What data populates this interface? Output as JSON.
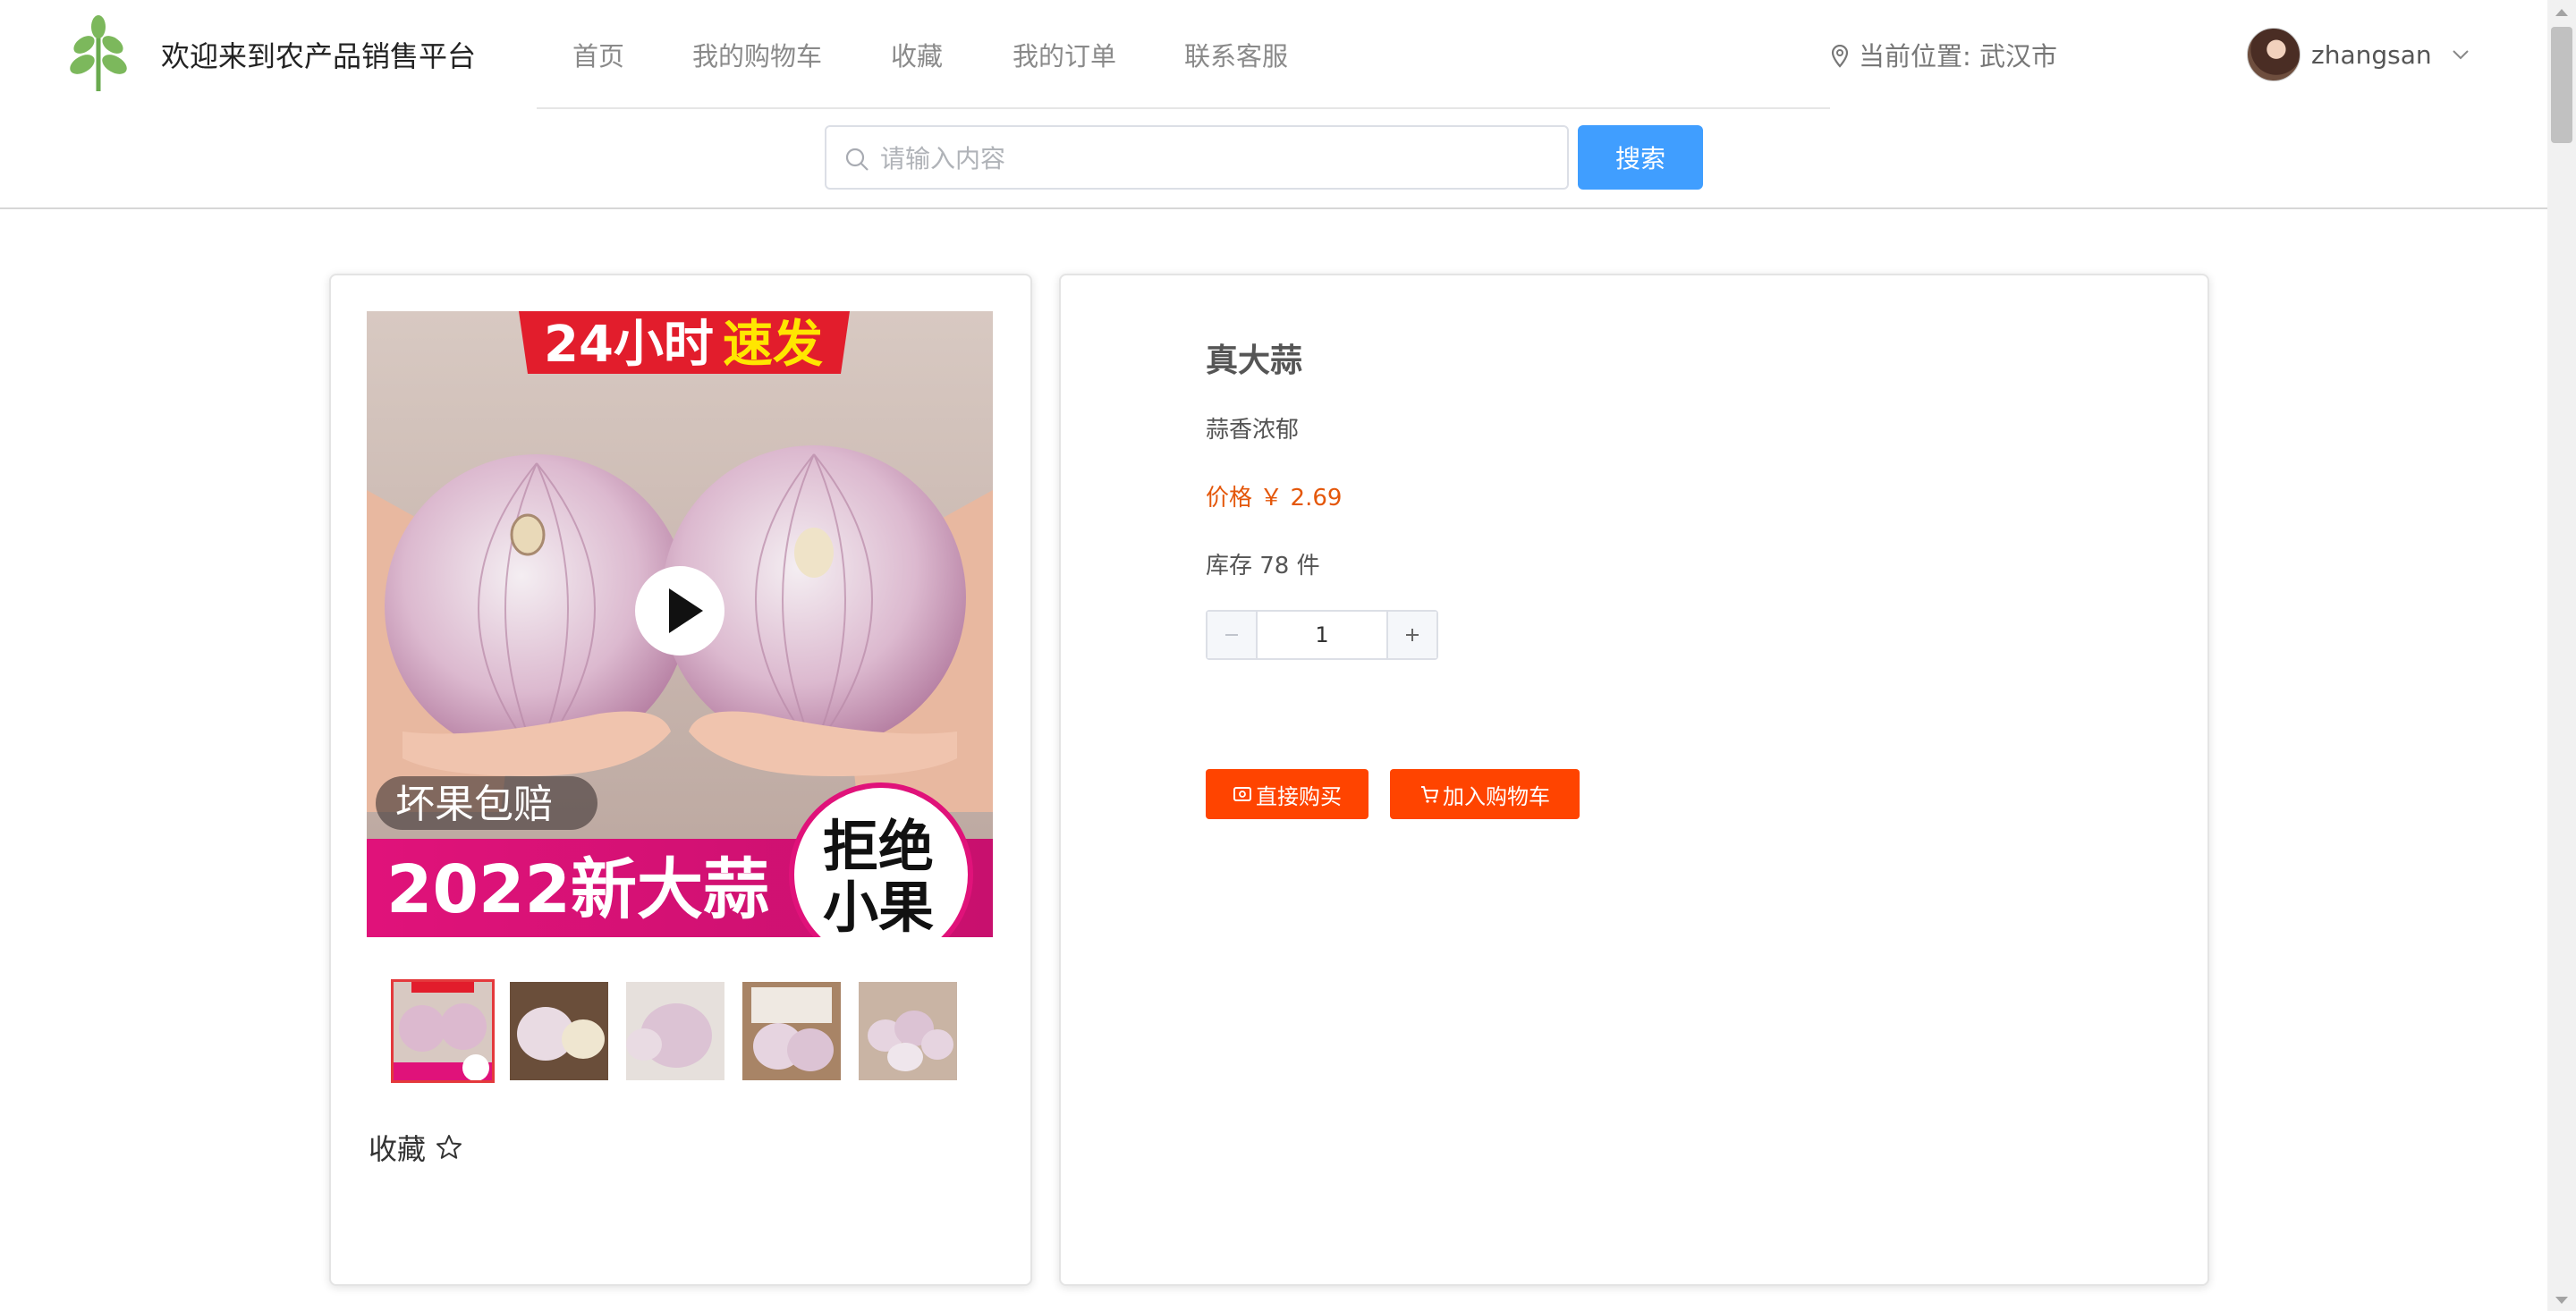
{
  "header": {
    "site_title": "欢迎来到农产品销售平台",
    "nav": [
      "首页",
      "我的购物车",
      "收藏",
      "我的订单",
      "联系客服"
    ],
    "location": "当前位置: 武汉市",
    "username": "zhangsan",
    "search_placeholder": "请输入内容",
    "search_button": "搜索",
    "logo_icon": "leaf-icon"
  },
  "gallery": {
    "main_banner_top": "24小时",
    "main_banner_top_highlight": "速发",
    "main_tag": "坏果包赔",
    "main_bottom": "2022新大蒜",
    "main_badge_line1": "拒绝",
    "main_badge_line2": "小果",
    "thumb_count": 5,
    "favorite_label": "收藏"
  },
  "product": {
    "name": "真大蒜",
    "description": "蒜香浓郁",
    "price_text": "价格 ￥ 2.69",
    "stock_text": "库存 78 件",
    "quantity": "1",
    "buy_now_label": "直接购买",
    "add_to_cart_label": "加入购物车"
  },
  "colors": {
    "accent_blue": "#409eff",
    "price_orange": "#e4570a",
    "buy_orange": "#ff4400",
    "logo_green": "#7cb85c"
  }
}
